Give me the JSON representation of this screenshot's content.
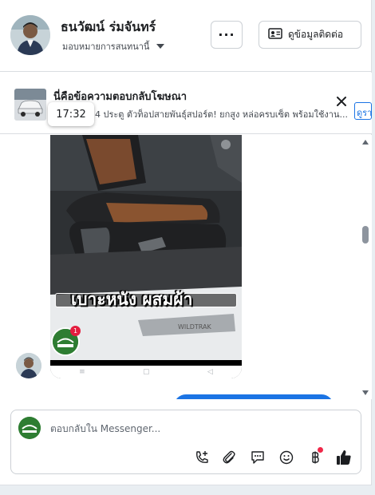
{
  "header": {
    "contact_name": "ธนวัฒน์ ร่มจันทร์",
    "assign_label": "มอบหมายการสนทนานี้",
    "more_label": "···",
    "contact_info_label": "ดูข้อมูลติดต่อ"
  },
  "ad": {
    "title": "นี่คือข้อความตอบกลับโฆษณา",
    "text": "4 ประตู ตัวท็อปสายพันธุ์สปอร์ต! ยกสูง หล่อครบเซ็ต พร้อมใช้งาน...",
    "link_label": "ดูรา",
    "time": "17:32"
  },
  "media": {
    "caption": "เบาะหนัง ผสมผ้า",
    "nav": [
      "≡",
      "▢",
      "◁"
    ],
    "badge_count": "1"
  },
  "composer": {
    "placeholder": "ตอบกลับใน Messenger..."
  },
  "colors": {
    "accent": "#1b74e4",
    "badge": "#e41e3f",
    "brand_green": "#2e7d32"
  },
  "icons": [
    "chevron-down-icon",
    "contact-card-icon",
    "close-icon",
    "phone-plus-icon",
    "paperclip-icon",
    "chat-bubble-icon",
    "emoji-icon",
    "baht-icon",
    "thumbs-up-icon"
  ]
}
